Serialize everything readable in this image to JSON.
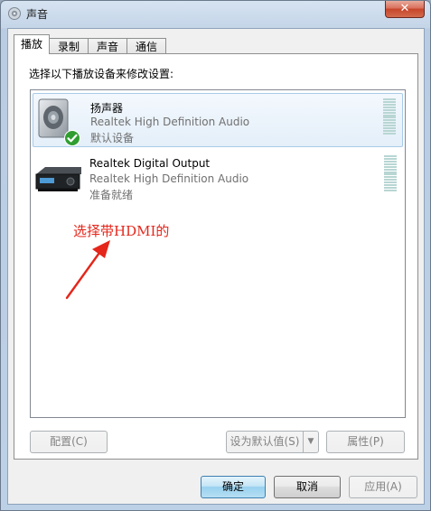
{
  "window": {
    "title": "声音",
    "close_label": "✕"
  },
  "tabs": [
    {
      "label": "播放",
      "active": true
    },
    {
      "label": "录制",
      "active": false
    },
    {
      "label": "声音",
      "active": false
    },
    {
      "label": "通信",
      "active": false
    }
  ],
  "playback": {
    "instruction": "选择以下播放设备来修改设置:",
    "devices": [
      {
        "name": "扬声器",
        "description": "Realtek High Definition Audio",
        "status": "默认设备",
        "selected": true,
        "icon": "speaker-icon"
      },
      {
        "name": "Realtek Digital Output",
        "description": "Realtek High Definition Audio",
        "status": "准备就绪",
        "selected": false,
        "icon": "digital-output-device-icon"
      }
    ],
    "annotation": "选择带HDMI的"
  },
  "buttons": {
    "configure": "配置(C)",
    "set_default": "设为默认值(S)",
    "properties": "属性(P)",
    "ok": "确定",
    "cancel": "取消",
    "apply": "应用(A)"
  },
  "colors": {
    "annotation": "#e4261b",
    "selection": "#e4eff9",
    "meter": "#b8d6d3"
  }
}
